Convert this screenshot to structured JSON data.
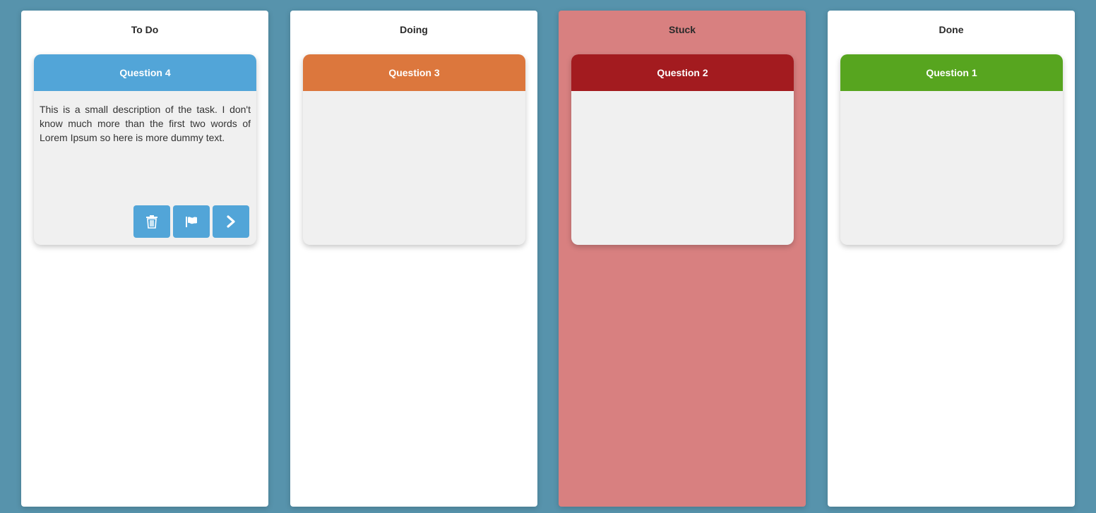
{
  "board": {
    "background": "#5793ac",
    "columns": [
      {
        "title": "To Do",
        "background": "#ffffff",
        "card": {
          "title": "Question 4",
          "header_color": "#52a5d8",
          "description": "This is a small description of the task. I don't know much more than the first two words of Lorem Ipsum so here is more dummy text.",
          "actions": [
            {
              "icon": "trash-icon"
            },
            {
              "icon": "flag-icon"
            },
            {
              "icon": "chevron-right-icon"
            }
          ]
        }
      },
      {
        "title": "Doing",
        "background": "#ffffff",
        "card": {
          "title": "Question 3",
          "header_color": "#dc773d"
        }
      },
      {
        "title": "Stuck",
        "background": "#d88080",
        "card": {
          "title": "Question 2",
          "header_color": "#a31b1f"
        }
      },
      {
        "title": "Done",
        "background": "#ffffff",
        "card": {
          "title": "Question 1",
          "header_color": "#57a51f"
        }
      }
    ]
  }
}
